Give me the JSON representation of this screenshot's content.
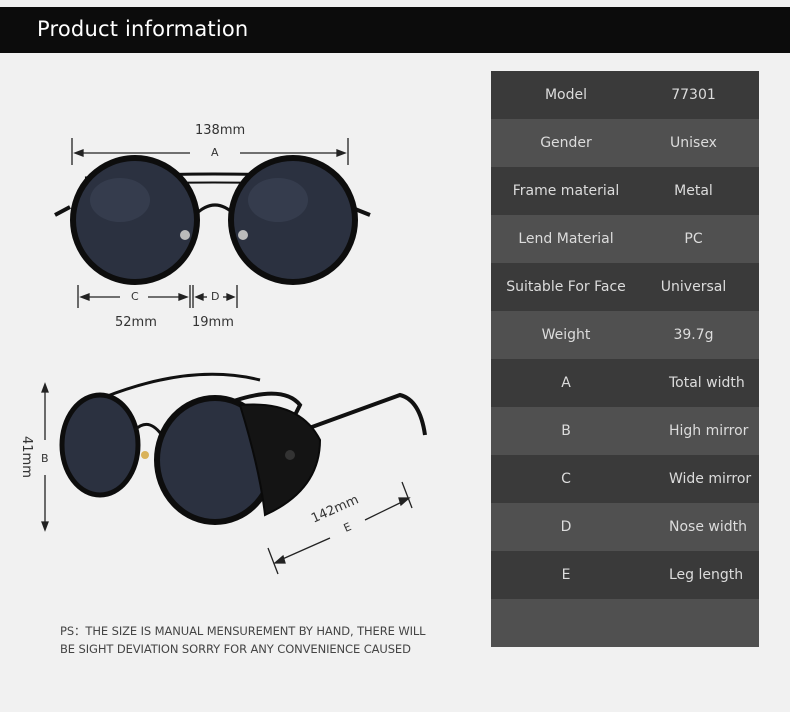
{
  "header": {
    "title": "Product information"
  },
  "colors": {
    "row_dark": "#3a3a3a",
    "row_light": "#505050",
    "header_bg": "#0c0c0c",
    "lens": "#2b3140"
  },
  "specs": [
    {
      "key": "Model",
      "value": "77301"
    },
    {
      "key": "Gender",
      "value": "Unisex"
    },
    {
      "key": "Frame material",
      "value": "Metal"
    },
    {
      "key": "Lend Material",
      "value": "PC"
    },
    {
      "key": "Suitable For Face",
      "value": "Universal"
    },
    {
      "key": "Weight",
      "value": "39.7g"
    }
  ],
  "dimension_legend": [
    {
      "key": "A",
      "value": "Total width"
    },
    {
      "key": "B",
      "value": "High mirror"
    },
    {
      "key": "C",
      "value": "Wide mirror"
    },
    {
      "key": "D",
      "value": "Nose width"
    },
    {
      "key": "E",
      "value": "Leg length"
    }
  ],
  "dimensions": {
    "a_value": "138mm",
    "a_letter": "A",
    "c_value": "52mm",
    "c_letter": "C",
    "d_value": "19mm",
    "d_letter": "D",
    "b_value": "41mm",
    "b_letter": "B",
    "e_value": "142mm",
    "e_letter": "E"
  },
  "note": {
    "line1": "PS：THE SIZE IS MANUAL MENSUREMENT BY HAND, THERE WILL",
    "line2": "BE SIGHT DEVIATION SORRY FOR ANY CONVENIENCE CAUSED"
  }
}
